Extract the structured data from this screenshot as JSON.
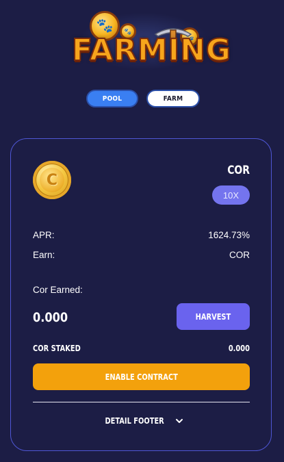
{
  "logo": {
    "text": "FARMING"
  },
  "tabs": [
    {
      "label": "POOL",
      "active": true
    },
    {
      "label": "FARM",
      "active": false
    }
  ],
  "card": {
    "token_icon": "coin-icon",
    "token_name": "COR",
    "multiplier": "10X",
    "apr_label": "APR:",
    "apr_value": "1624.73%",
    "earn_label": "Earn:",
    "earn_value": "COR",
    "earned_label": "Cor Earned:",
    "earned_value": "0.000",
    "harvest_label": "HARVEST",
    "staked_label": "COR STAKED",
    "staked_value": "0.000",
    "enable_label": "ENABLE CONTRACT",
    "footer_label": "DETAIL FOOTER",
    "footer_icon": "chevron-down-icon"
  },
  "colors": {
    "background": "#1c1d45",
    "card_border": "#4f57d6",
    "tab_active": "#3a7ff2",
    "multiplier_badge": "#7474ee",
    "harvest_button": "#6a63ee",
    "enable_button": "#f3a10c"
  }
}
